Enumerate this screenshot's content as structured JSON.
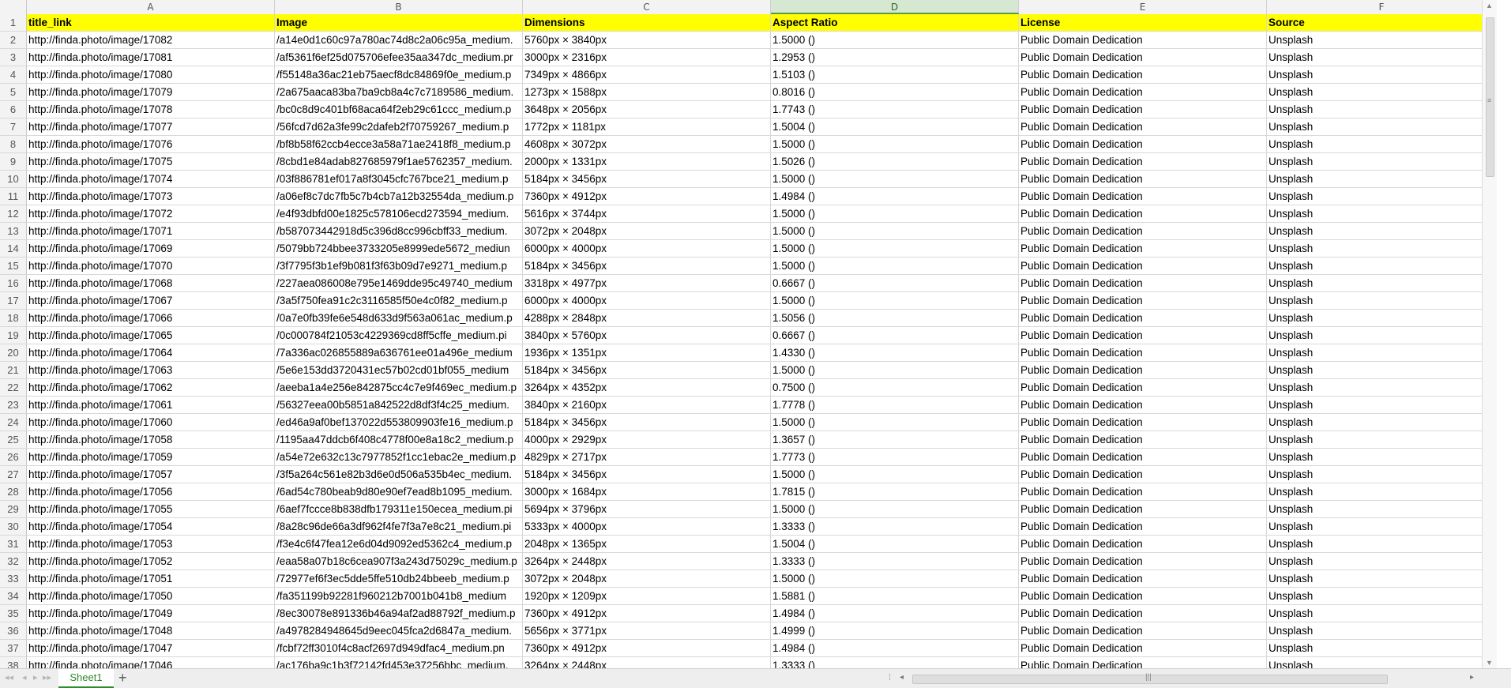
{
  "columns": [
    "A",
    "B",
    "C",
    "D",
    "E",
    "F"
  ],
  "active_column": "D",
  "header_row": {
    "number": "1",
    "cells": [
      "title_link",
      "Image",
      "Dimensions",
      "Aspect Ratio",
      "License",
      "Source"
    ]
  },
  "rows": [
    {
      "n": "2",
      "cells": [
        "http://finda.photo/image/17082",
        "/a14e0d1c60c97a780ac74d8c2a06c95a_medium.",
        "5760px × 3840px",
        "1.5000 ()",
        "Public Domain Dedication",
        "Unsplash"
      ]
    },
    {
      "n": "3",
      "cells": [
        "http://finda.photo/image/17081",
        "/af5361f6ef25d075706efee35aa347dc_medium.pr",
        "3000px × 2316px",
        "1.2953 ()",
        "Public Domain Dedication",
        "Unsplash"
      ]
    },
    {
      "n": "4",
      "cells": [
        "http://finda.photo/image/17080",
        "/f55148a36ac21eb75aecf8dc84869f0e_medium.p",
        "7349px × 4866px",
        "1.5103 ()",
        "Public Domain Dedication",
        "Unsplash"
      ]
    },
    {
      "n": "5",
      "cells": [
        "http://finda.photo/image/17079",
        "/2a675aaca83ba7ba9cb8a4c7c7189586_medium.",
        "1273px × 1588px",
        "0.8016 ()",
        "Public Domain Dedication",
        "Unsplash"
      ]
    },
    {
      "n": "6",
      "cells": [
        "http://finda.photo/image/17078",
        "/bc0c8d9c401bf68aca64f2eb29c61ccc_medium.p",
        "3648px × 2056px",
        "1.7743 ()",
        "Public Domain Dedication",
        "Unsplash"
      ]
    },
    {
      "n": "7",
      "cells": [
        "http://finda.photo/image/17077",
        "/56fcd7d62a3fe99c2dafeb2f70759267_medium.p",
        "1772px × 1181px",
        "1.5004 ()",
        "Public Domain Dedication",
        "Unsplash"
      ]
    },
    {
      "n": "8",
      "cells": [
        "http://finda.photo/image/17076",
        "/bf8b58f62ccb4ecce3a58a71ae2418f8_medium.p",
        "4608px × 3072px",
        "1.5000 ()",
        "Public Domain Dedication",
        "Unsplash"
      ]
    },
    {
      "n": "9",
      "cells": [
        "http://finda.photo/image/17075",
        "/8cbd1e84adab827685979f1ae5762357_medium.",
        "2000px × 1331px",
        "1.5026 ()",
        "Public Domain Dedication",
        "Unsplash"
      ]
    },
    {
      "n": "10",
      "cells": [
        "http://finda.photo/image/17074",
        "/03f886781ef017a8f3045cfc767bce21_medium.p",
        "5184px × 3456px",
        "1.5000 ()",
        "Public Domain Dedication",
        "Unsplash"
      ]
    },
    {
      "n": "11",
      "cells": [
        "http://finda.photo/image/17073",
        "/a06ef8c7dc7fb5c7b4cb7a12b32554da_medium.p",
        "7360px × 4912px",
        "1.4984 ()",
        "Public Domain Dedication",
        "Unsplash"
      ]
    },
    {
      "n": "12",
      "cells": [
        "http://finda.photo/image/17072",
        "/e4f93dbfd00e1825c578106ecd273594_medium.",
        "5616px × 3744px",
        "1.5000 ()",
        "Public Domain Dedication",
        "Unsplash"
      ]
    },
    {
      "n": "13",
      "cells": [
        "http://finda.photo/image/17071",
        "/b587073442918d5c396d8cc996cbff33_medium.",
        "3072px × 2048px",
        "1.5000 ()",
        "Public Domain Dedication",
        "Unsplash"
      ]
    },
    {
      "n": "14",
      "cells": [
        "http://finda.photo/image/17069",
        "/5079bb724bbee3733205e8999ede5672_mediun",
        "6000px × 4000px",
        "1.5000 ()",
        "Public Domain Dedication",
        "Unsplash"
      ]
    },
    {
      "n": "15",
      "cells": [
        "http://finda.photo/image/17070",
        "/3f7795f3b1ef9b081f3f63b09d7e9271_medium.p",
        "5184px × 3456px",
        "1.5000 ()",
        "Public Domain Dedication",
        "Unsplash"
      ]
    },
    {
      "n": "16",
      "cells": [
        "http://finda.photo/image/17068",
        "/227aea086008e795e1469dde95c49740_medium",
        "3318px × 4977px",
        "0.6667 ()",
        "Public Domain Dedication",
        "Unsplash"
      ]
    },
    {
      "n": "17",
      "cells": [
        "http://finda.photo/image/17067",
        "/3a5f750fea91c2c3116585f50e4c0f82_medium.p",
        "6000px × 4000px",
        "1.5000 ()",
        "Public Domain Dedication",
        "Unsplash"
      ]
    },
    {
      "n": "18",
      "cells": [
        "http://finda.photo/image/17066",
        "/0a7e0fb39fe6e548d633d9f563a061ac_medium.p",
        "4288px × 2848px",
        "1.5056 ()",
        "Public Domain Dedication",
        "Unsplash"
      ]
    },
    {
      "n": "19",
      "cells": [
        "http://finda.photo/image/17065",
        "/0c000784f21053c4229369cd8ff5cffe_medium.pi",
        "3840px × 5760px",
        "0.6667 ()",
        "Public Domain Dedication",
        "Unsplash"
      ]
    },
    {
      "n": "20",
      "cells": [
        "http://finda.photo/image/17064",
        "/7a336ac026855889a636761ee01a496e_medium",
        "1936px × 1351px",
        "1.4330 ()",
        "Public Domain Dedication",
        "Unsplash"
      ]
    },
    {
      "n": "21",
      "cells": [
        "http://finda.photo/image/17063",
        "/5e6e153dd3720431ec57b02cd01bf055_medium",
        "5184px × 3456px",
        "1.5000 ()",
        "Public Domain Dedication",
        "Unsplash"
      ]
    },
    {
      "n": "22",
      "cells": [
        "http://finda.photo/image/17062",
        "/aeeba1a4e256e842875cc4c7e9f469ec_medium.p",
        "3264px × 4352px",
        "0.7500 ()",
        "Public Domain Dedication",
        "Unsplash"
      ]
    },
    {
      "n": "23",
      "cells": [
        "http://finda.photo/image/17061",
        "/56327eea00b5851a842522d8df3f4c25_medium.",
        "3840px × 2160px",
        "1.7778 ()",
        "Public Domain Dedication",
        "Unsplash"
      ]
    },
    {
      "n": "24",
      "cells": [
        "http://finda.photo/image/17060",
        "/ed46a9af0bef137022d553809903fe16_medium.p",
        "5184px × 3456px",
        "1.5000 ()",
        "Public Domain Dedication",
        "Unsplash"
      ]
    },
    {
      "n": "25",
      "cells": [
        "http://finda.photo/image/17058",
        "/1195aa47ddcb6f408c4778f00e8a18c2_medium.p",
        "4000px × 2929px",
        "1.3657 ()",
        "Public Domain Dedication",
        "Unsplash"
      ]
    },
    {
      "n": "26",
      "cells": [
        "http://finda.photo/image/17059",
        "/a54e72e632c13c7977852f1cc1ebac2e_medium.p",
        "4829px × 2717px",
        "1.7773 ()",
        "Public Domain Dedication",
        "Unsplash"
      ]
    },
    {
      "n": "27",
      "cells": [
        "http://finda.photo/image/17057",
        "/3f5a264c561e82b3d6e0d506a535b4ec_medium.",
        "5184px × 3456px",
        "1.5000 ()",
        "Public Domain Dedication",
        "Unsplash"
      ]
    },
    {
      "n": "28",
      "cells": [
        "http://finda.photo/image/17056",
        "/6ad54c780beab9d80e90ef7ead8b1095_medium.",
        "3000px × 1684px",
        "1.7815 ()",
        "Public Domain Dedication",
        "Unsplash"
      ]
    },
    {
      "n": "29",
      "cells": [
        "http://finda.photo/image/17055",
        "/6aef7fccce8b838dfb179311e150ecea_medium.pi",
        "5694px × 3796px",
        "1.5000 ()",
        "Public Domain Dedication",
        "Unsplash"
      ]
    },
    {
      "n": "30",
      "cells": [
        "http://finda.photo/image/17054",
        "/8a28c96de66a3df962f4fe7f3a7e8c21_medium.pi",
        "5333px × 4000px",
        "1.3333 ()",
        "Public Domain Dedication",
        "Unsplash"
      ]
    },
    {
      "n": "31",
      "cells": [
        "http://finda.photo/image/17053",
        "/f3e4c6f47fea12e6d04d9092ed5362c4_medium.p",
        "2048px × 1365px",
        "1.5004 ()",
        "Public Domain Dedication",
        "Unsplash"
      ]
    },
    {
      "n": "32",
      "cells": [
        "http://finda.photo/image/17052",
        "/eaa58a07b18c6cea907f3a243d75029c_medium.p",
        "3264px × 2448px",
        "1.3333 ()",
        "Public Domain Dedication",
        "Unsplash"
      ]
    },
    {
      "n": "33",
      "cells": [
        "http://finda.photo/image/17051",
        "/72977ef6f3ec5dde5ffe510db24bbeeb_medium.p",
        "3072px × 2048px",
        "1.5000 ()",
        "Public Domain Dedication",
        "Unsplash"
      ]
    },
    {
      "n": "34",
      "cells": [
        "http://finda.photo/image/17050",
        "/fa351199b92281f960212b7001b041b8_medium",
        "1920px × 1209px",
        "1.5881 ()",
        "Public Domain Dedication",
        "Unsplash"
      ]
    },
    {
      "n": "35",
      "cells": [
        "http://finda.photo/image/17049",
        "/8ec30078e891336b46a94af2ad88792f_medium.p",
        "7360px × 4912px",
        "1.4984 ()",
        "Public Domain Dedication",
        "Unsplash"
      ]
    },
    {
      "n": "36",
      "cells": [
        "http://finda.photo/image/17048",
        "/a4978284948645d9eec045fca2d6847a_medium.",
        "5656px × 3771px",
        "1.4999 ()",
        "Public Domain Dedication",
        "Unsplash"
      ]
    },
    {
      "n": "37",
      "cells": [
        "http://finda.photo/image/17047",
        "/fcbf72ff3010f4c8acf2697d949dfac4_medium.pn",
        "7360px × 4912px",
        "1.4984 ()",
        "Public Domain Dedication",
        "Unsplash"
      ]
    },
    {
      "n": "38",
      "cells": [
        "http://finda.photo/image/17046",
        "/ac176ba9c1b3f72142fd453e37256bbc_medium.",
        "3264px × 2448px",
        "1.3333 ()",
        "Public Domain Dedication",
        "Unsplash"
      ]
    }
  ],
  "sheet_tab": {
    "label": "Sheet1"
  },
  "icons": {
    "first": "◂◂",
    "prev": "◂",
    "next": "▸",
    "last": "▸▸",
    "add": "+",
    "up": "▲",
    "down": "▼",
    "grip_v": "≡",
    "grip_h": "|||",
    "sep": "⁞"
  },
  "colors": {
    "header_fill": "#ffff00",
    "active_tab": "#2d8a2d"
  }
}
